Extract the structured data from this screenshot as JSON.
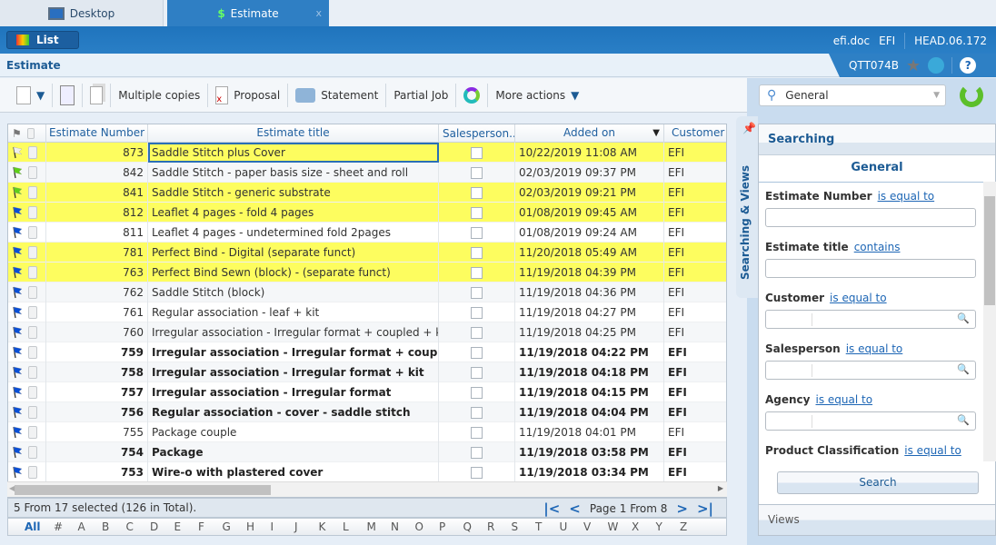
{
  "tabs": [
    {
      "label": "Desktop",
      "icon": "monitor-icon"
    },
    {
      "label": "Estimate",
      "icon": "dollar-doc-icon",
      "close": "x"
    }
  ],
  "topbar": {
    "list_label": "List",
    "user": "efi.doc",
    "company": "EFI",
    "version": "HEAD.06.172",
    "workstation": "QTT074B"
  },
  "page_title": "Estimate",
  "toolbar": {
    "multiple_copies": "Multiple copies",
    "proposal": "Proposal",
    "statement": "Statement",
    "partial_job": "Partial Job",
    "more_actions": "More actions"
  },
  "grid": {
    "columns": [
      "Estimate Number",
      "Estimate title",
      "Salesperson...",
      "Added on",
      "Customer"
    ],
    "sort_column": "Added on",
    "sort_dir": "desc",
    "rows": [
      {
        "flag": "white",
        "num": "873",
        "title": "Saddle Stitch plus Cover",
        "added": "10/22/2019 11:08 AM",
        "customer": "EFI",
        "selected": true,
        "bold": false
      },
      {
        "flag": "green",
        "num": "842",
        "title": "Saddle Stitch - paper basis size - sheet and roll",
        "added": "02/03/2019 09:37 PM",
        "customer": "EFI",
        "selected": false,
        "bold": false
      },
      {
        "flag": "green",
        "num": "841",
        "title": "Saddle Stitch - generic substrate",
        "added": "02/03/2019 09:21 PM",
        "customer": "EFI",
        "selected": true,
        "bold": false
      },
      {
        "flag": "blue",
        "num": "812",
        "title": "Leaflet 4 pages - fold 4 pages",
        "added": "01/08/2019 09:45 AM",
        "customer": "EFI",
        "selected": true,
        "bold": false
      },
      {
        "flag": "blue",
        "num": "811",
        "title": "Leaflet 4 pages - undetermined fold 2pages",
        "added": "01/08/2019 09:24 AM",
        "customer": "EFI",
        "selected": false,
        "bold": false
      },
      {
        "flag": "blue",
        "num": "781",
        "title": "Perfect Bind - Digital (separate funct)",
        "added": "11/20/2018 05:49 AM",
        "customer": "EFI",
        "selected": true,
        "bold": false
      },
      {
        "flag": "blue",
        "num": "763",
        "title": "Perfect Bind Sewn (block) - (separate funct)",
        "added": "11/19/2018 04:39 PM",
        "customer": "EFI",
        "selected": true,
        "bold": false
      },
      {
        "flag": "blue",
        "num": "762",
        "title": "Saddle Stitch (block)",
        "added": "11/19/2018 04:36 PM",
        "customer": "EFI",
        "selected": false,
        "bold": false
      },
      {
        "flag": "blue",
        "num": "761",
        "title": "Regular association - leaf + kit",
        "added": "11/19/2018 04:27 PM",
        "customer": "EFI",
        "selected": false,
        "bold": false
      },
      {
        "flag": "blue",
        "num": "760",
        "title": "Irregular association - Irregular format + coupled + kit",
        "added": "11/19/2018 04:25 PM",
        "customer": "EFI",
        "selected": false,
        "bold": false
      },
      {
        "flag": "blue",
        "num": "759",
        "title": "Irregular association - Irregular format + coupled",
        "added": "11/19/2018 04:22 PM",
        "customer": "EFI",
        "selected": false,
        "bold": true
      },
      {
        "flag": "blue",
        "num": "758",
        "title": "Irregular association - Irregular format + kit",
        "added": "11/19/2018 04:18 PM",
        "customer": "EFI",
        "selected": false,
        "bold": true
      },
      {
        "flag": "blue",
        "num": "757",
        "title": "Irregular association - Irregular format",
        "added": "11/19/2018 04:15 PM",
        "customer": "EFI",
        "selected": false,
        "bold": true
      },
      {
        "flag": "blue",
        "num": "756",
        "title": "Regular association - cover - saddle stitch",
        "added": "11/19/2018 04:04 PM",
        "customer": "EFI",
        "selected": false,
        "bold": true
      },
      {
        "flag": "blue",
        "num": "755",
        "title": "Package couple",
        "added": "11/19/2018 04:01 PM",
        "customer": "EFI",
        "selected": false,
        "bold": false
      },
      {
        "flag": "blue",
        "num": "754",
        "title": "Package",
        "added": "11/19/2018 03:58 PM",
        "customer": "EFI",
        "selected": false,
        "bold": true
      },
      {
        "flag": "blue",
        "num": "753",
        "title": "Wire-o with plastered cover",
        "added": "11/19/2018 03:34 PM",
        "customer": "EFI",
        "selected": false,
        "bold": true
      }
    ]
  },
  "status": {
    "text": "5 From 17 selected (126 in Total).",
    "page": "Page 1 From 8"
  },
  "alphabet": [
    "All",
    "#",
    "A",
    "B",
    "C",
    "D",
    "E",
    "F",
    "G",
    "H",
    "I",
    "J",
    "K",
    "L",
    "M",
    "N",
    "O",
    "P",
    "Q",
    "R",
    "S",
    "T",
    "U",
    "V",
    "W",
    "X",
    "Y",
    "Z"
  ],
  "search": {
    "selector": "General",
    "tab_label": "Searching & Views",
    "heading": "Searching",
    "group": "General",
    "fields": [
      {
        "label": "Estimate Number",
        "op": "is equal to",
        "lookup": false
      },
      {
        "label": "Estimate title",
        "op": "contains",
        "lookup": false
      },
      {
        "label": "Customer",
        "op": "is equal to",
        "lookup": true
      },
      {
        "label": "Salesperson",
        "op": "is equal to",
        "lookup": true
      },
      {
        "label": "Agency",
        "op": "is equal to",
        "lookup": true
      },
      {
        "label": "Product Classification",
        "op": "is equal to",
        "lookup": true
      }
    ],
    "button": "Search",
    "views": "Views"
  },
  "colors": {
    "flag_blue": "#0a4fd6",
    "flag_green": "#5fcf1a",
    "flag_white": "#eeeeee",
    "selected_row": "#fdfd5f",
    "accent": "#2a7fc6"
  }
}
